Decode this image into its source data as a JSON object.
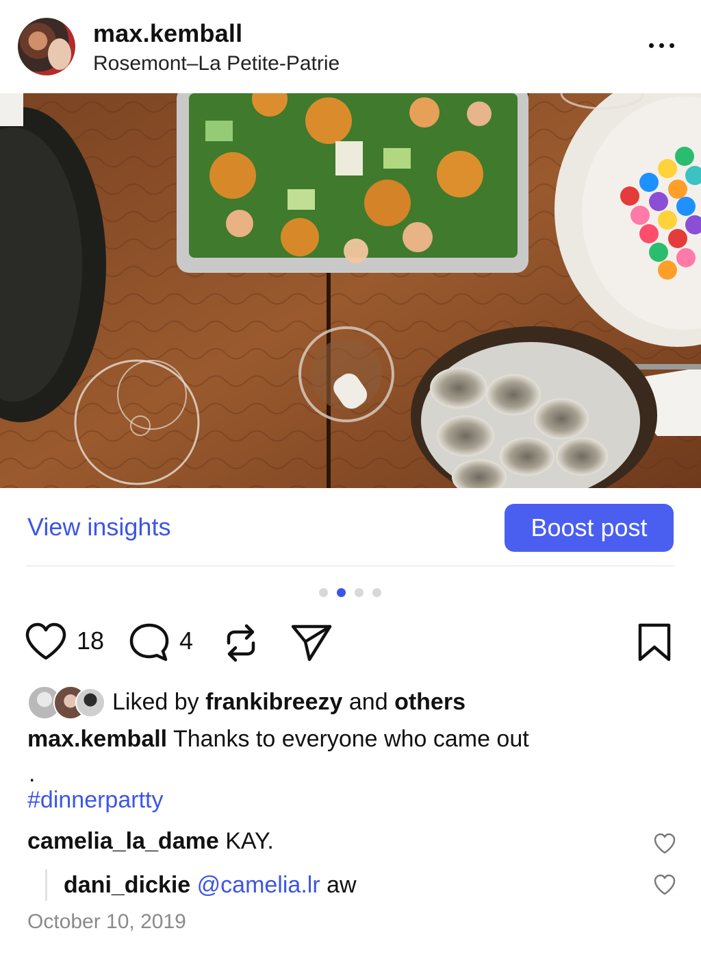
{
  "post": {
    "username": "max.kemball",
    "location": "Rosemont–La Petite-Patrie",
    "more_icon": "more-horizontal-icon"
  },
  "photo": {
    "description_icon": "photo-dinner-table",
    "carousel_total": 4,
    "carousel_active_index": 1
  },
  "insights": {
    "view_label": "View insights",
    "boost_label": "Boost post"
  },
  "engagement": {
    "likes_count": "18",
    "comments_count": "4"
  },
  "likes_summary": {
    "prefix": "Liked by",
    "user": "frankibreezy",
    "joiner": "and",
    "others": "others"
  },
  "caption": {
    "user": "max.kemball",
    "text": "Thanks to everyone who came out",
    "dot": ".",
    "hashtag": "#dinnerpartty"
  },
  "comments": [
    {
      "user": "camelia_la_dame",
      "text": "KAY."
    }
  ],
  "replies": [
    {
      "user": "dani_dickie",
      "mention": "@camelia.lr",
      "text": "aw"
    }
  ],
  "date": "October 10, 2019",
  "colors": {
    "accent": "#3d55e6",
    "button": "#4a5ff0",
    "muted": "#8a8a8a"
  }
}
